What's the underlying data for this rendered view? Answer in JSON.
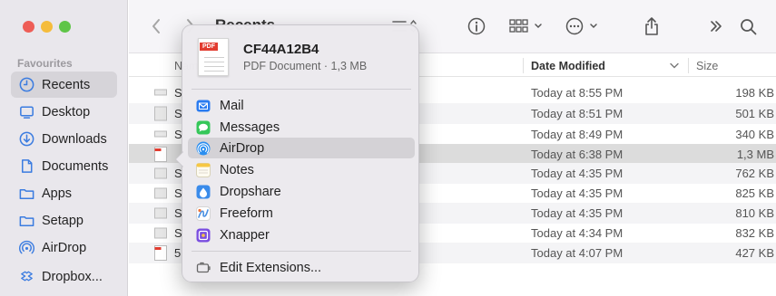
{
  "window": {
    "title": "Recents"
  },
  "sidebar": {
    "header": "Favourites",
    "items": [
      {
        "label": "Recents",
        "icon": "clock-icon",
        "active": true
      },
      {
        "label": "Desktop",
        "icon": "desktop-icon"
      },
      {
        "label": "Downloads",
        "icon": "download-icon"
      },
      {
        "label": "Documents",
        "icon": "document-icon"
      },
      {
        "label": "Apps",
        "icon": "apps-icon"
      },
      {
        "label": "Setapp",
        "icon": "folder-icon"
      },
      {
        "label": "AirDrop",
        "icon": "airdrop-icon"
      },
      {
        "label": "Dropbox...",
        "icon": "dropbox-icon"
      }
    ]
  },
  "columns": {
    "name": "Name",
    "date": "Date Modified",
    "size": "Size"
  },
  "rows": [
    {
      "name": "S",
      "date": "Today at 8:55 PM",
      "size": "198 KB"
    },
    {
      "name": "S",
      "date": "Today at 8:51 PM",
      "size": "501 KB"
    },
    {
      "name": "S",
      "date": "Today at 8:49 PM",
      "size": "340 KB"
    },
    {
      "name": "",
      "date": "Today at 6:38 PM",
      "size": "1,3 MB",
      "selected": true
    },
    {
      "name": "S",
      "date": "Today at 4:35 PM",
      "size": "762 KB"
    },
    {
      "name": "S",
      "date": "Today at 4:35 PM",
      "size": "825 KB"
    },
    {
      "name": "S",
      "date": "Today at 4:35 PM",
      "size": "810 KB"
    },
    {
      "name": "S",
      "date": "Today at 4:34 PM",
      "size": "832 KB"
    },
    {
      "name": "5",
      "date": "Today at 4:07 PM",
      "size": "427 KB"
    }
  ],
  "share_menu": {
    "file_name": "CF44A12B4",
    "file_meta": "PDF Document · 1,3 MB",
    "thumb_label": "PDF",
    "items": [
      {
        "label": "Mail",
        "icon": "mail-icon",
        "color": "#2a7bf0"
      },
      {
        "label": "Messages",
        "icon": "messages-icon",
        "color": "#35c759"
      },
      {
        "label": "AirDrop",
        "icon": "airdrop-icon",
        "color": "#2a8ef0",
        "highlighted": true
      },
      {
        "label": "Notes",
        "icon": "notes-icon",
        "color": "#f6c744"
      },
      {
        "label": "Dropshare",
        "icon": "dropshare-icon",
        "color": "#3a8bea"
      },
      {
        "label": "Freeform",
        "icon": "freeform-icon",
        "color": "#4a90e2"
      },
      {
        "label": "Xnapper",
        "icon": "xnapper-icon",
        "color": "#7a4ee0"
      }
    ],
    "footer": "Edit Extensions..."
  }
}
